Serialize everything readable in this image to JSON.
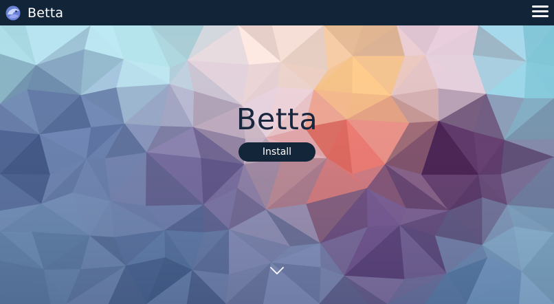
{
  "nav": {
    "brand": "Betta",
    "logo_icon": "betta-fish-logo-icon",
    "menu_icon": "hamburger-menu-icon"
  },
  "hero": {
    "title": "Betta",
    "install_label": "Install",
    "scroll_icon": "chevron-down-icon"
  },
  "colors": {
    "navbar": "#122438",
    "title": "#18273d",
    "button": "#132539",
    "text_light": "#ffffff"
  }
}
